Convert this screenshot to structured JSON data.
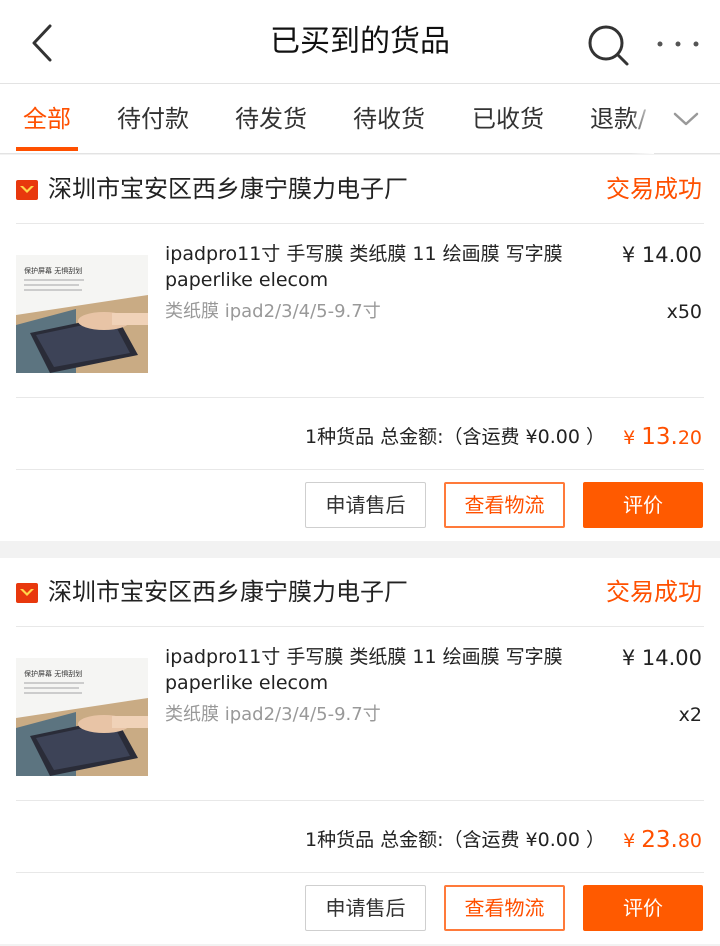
{
  "header": {
    "title": "已买到的货品",
    "back_icon": "chevron-left-icon",
    "search_icon": "search-icon",
    "more_icon": "more-dots-icon"
  },
  "tabs": [
    {
      "label": "全部",
      "active": true
    },
    {
      "label": "待付款",
      "active": false
    },
    {
      "label": "待发货",
      "active": false
    },
    {
      "label": "待收货",
      "active": false
    },
    {
      "label": "已收货",
      "active": false
    },
    {
      "label": "退款/",
      "active": false
    }
  ],
  "tabs_more_icon": "chevron-down-icon",
  "theme": {
    "accent": "#ff5000",
    "accent_button": "#ff5a00"
  },
  "orders": [
    {
      "shop_name": "深圳市宝安区西乡康宁膜力电子厂",
      "status": "交易成功",
      "product": {
        "title": "ipadpro11寸 手写膜 类纸膜 11 绘画膜 写字膜 paperlike elecom",
        "price": "¥ 14.00",
        "sku": "类纸膜 ipad2/3/4/5-9.7寸",
        "qty": "x50",
        "thumb_caption": "保护屏幕 无惧刮划"
      },
      "summary": {
        "text": "1种货品 总金额:（含运费 ¥0.00 ）",
        "total_currency": "¥ ",
        "total_int": "13.",
        "total_dec": "20"
      },
      "buttons": {
        "aftersale": "申请售后",
        "logistics": "查看物流",
        "review": "评价"
      }
    },
    {
      "shop_name": "深圳市宝安区西乡康宁膜力电子厂",
      "status": "交易成功",
      "product": {
        "title": "ipadpro11寸 手写膜 类纸膜 11 绘画膜 写字膜 paperlike elecom",
        "price": "¥ 14.00",
        "sku": "类纸膜 ipad2/3/4/5-9.7寸",
        "qty": "x2",
        "thumb_caption": "保护屏幕 无惧刮划"
      },
      "summary": {
        "text": "1种货品 总金额:（含运费 ¥0.00 ）",
        "total_currency": "¥ ",
        "total_int": "23.",
        "total_dec": "80"
      },
      "buttons": {
        "aftersale": "申请售后",
        "logistics": "查看物流",
        "review": "评价"
      }
    }
  ]
}
